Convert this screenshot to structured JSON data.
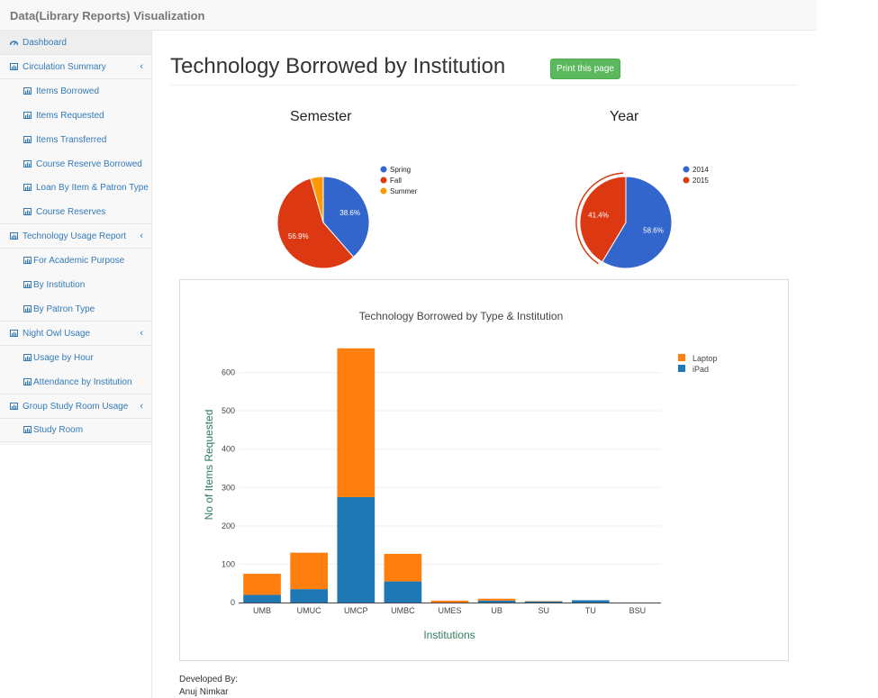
{
  "app": {
    "title": "Data(Library Reports) Visualization"
  },
  "sidebar": {
    "items": [
      {
        "label": "Dashboard",
        "level": 0,
        "icon": "dashboard-icon"
      },
      {
        "label": "Circulation Summary",
        "level": 0,
        "icon": "bar-chart-icon",
        "expandable": true
      },
      {
        "label": "Items Borrowed",
        "level": 1,
        "icon": "bar-chart-icon"
      },
      {
        "label": "Items Requested",
        "level": 1,
        "icon": "bar-chart-icon"
      },
      {
        "label": "Items Transferred",
        "level": 1,
        "icon": "bar-chart-icon"
      },
      {
        "label": "Course Reserve Borrowed",
        "level": 1,
        "icon": "bar-chart-icon"
      },
      {
        "label": "Loan By Item & Patron Type",
        "level": 1,
        "icon": "bar-chart-icon"
      },
      {
        "label": "Course Reserves",
        "level": 1,
        "icon": "bar-chart-icon"
      },
      {
        "label": "Technology Usage Report",
        "level": 0,
        "icon": "bar-chart-icon",
        "expandable": true
      },
      {
        "label": "For Academic Purpose",
        "level": 1,
        "icon": "bar-chart-icon"
      },
      {
        "label": "By Institution",
        "level": 1,
        "icon": "bar-chart-icon"
      },
      {
        "label": "By Patron Type",
        "level": 1,
        "icon": "bar-chart-icon"
      },
      {
        "label": "Night Owl Usage",
        "level": 0,
        "icon": "bar-chart-icon",
        "expandable": true
      },
      {
        "label": "Usage by Hour",
        "level": 1,
        "icon": "bar-chart-icon"
      },
      {
        "label": "Attendance by Institution",
        "level": 1,
        "icon": "bar-chart-icon"
      },
      {
        "label": "Group Study Room Usage",
        "level": 0,
        "icon": "bar-chart-icon",
        "expandable": true
      },
      {
        "label": "Study Room",
        "level": 1,
        "icon": "bar-chart-icon"
      }
    ],
    "chevron": "‹"
  },
  "main": {
    "title": "Technology Borrowed by Institution",
    "print_label": "Print this page"
  },
  "colors": {
    "spring": "#3366cc",
    "fall": "#dc3912",
    "summer": "#ff9900",
    "laptop": "#ff7f0e",
    "ipad": "#1f77b4",
    "accent": "#5cb85c",
    "link": "#337ab7"
  },
  "chart_data": [
    {
      "type": "pie",
      "title": "Semester",
      "slices": [
        {
          "label": "Spring",
          "value": 38.6,
          "text": "38.6%",
          "color": "#3366cc"
        },
        {
          "label": "Fall",
          "value": 56.9,
          "text": "56.9%",
          "color": "#dc3912"
        },
        {
          "label": "Summer",
          "value": 4.5,
          "text": "",
          "color": "#ff9900"
        }
      ]
    },
    {
      "type": "pie",
      "title": "Year",
      "selected": "2015",
      "slices": [
        {
          "label": "2014",
          "value": 58.6,
          "text": "58.6%",
          "color": "#3366cc"
        },
        {
          "label": "2015",
          "value": 41.4,
          "text": "41.4%",
          "color": "#dc3912"
        }
      ]
    },
    {
      "type": "bar",
      "stacked": true,
      "title": "Technology Borrowed by Type & Institution",
      "xlabel": "Institutions",
      "ylabel": "No of Items Requested",
      "categories": [
        "UMB",
        "UMUC",
        "UMCP",
        "UMBC",
        "UMES",
        "UB",
        "SU",
        "TU",
        "BSU"
      ],
      "series": [
        {
          "name": "iPad",
          "color": "#1f77b4",
          "values": [
            20,
            35,
            275,
            55,
            0,
            5,
            3,
            6,
            0
          ]
        },
        {
          "name": "Laptop",
          "color": "#ff7f0e",
          "values": [
            55,
            95,
            388,
            72,
            5,
            5,
            1,
            0,
            0
          ]
        }
      ],
      "legend_order": [
        "Laptop",
        "iPad"
      ],
      "yticks": [
        0,
        100,
        200,
        300,
        400,
        500,
        600
      ],
      "ylim": [
        0,
        700
      ],
      "grid": true,
      "legend": "top-right"
    }
  ],
  "footer": {
    "line1": "Developed By:",
    "line2": "Anuj Nimkar"
  }
}
